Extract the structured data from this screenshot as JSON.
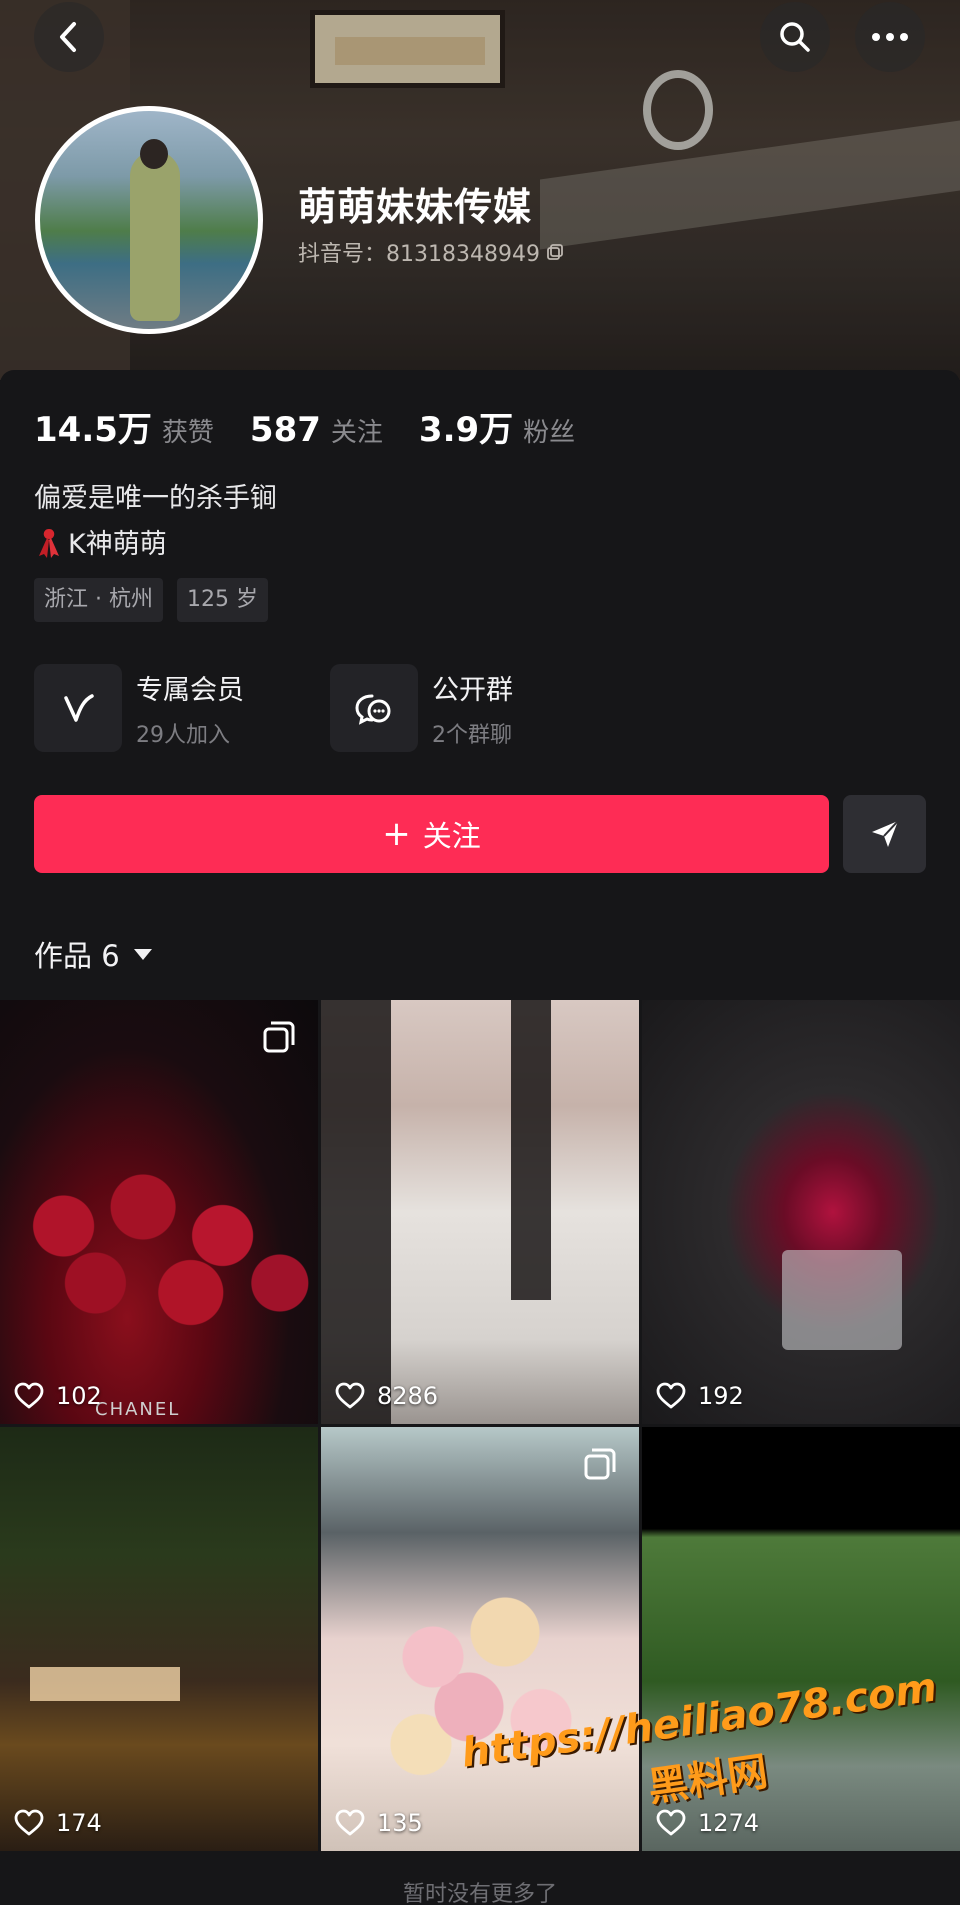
{
  "profile": {
    "name": "萌萌妹妹传媒",
    "douyin_id": "抖音号：81318348949",
    "stats": {
      "likes": {
        "value": "14.5万",
        "label": "获赞"
      },
      "following": {
        "value": "587",
        "label": "关注"
      },
      "followers": {
        "value": "3.9万",
        "label": "粉丝"
      }
    },
    "bio_line1": "偏爱是唯一的杀手锏",
    "bio_line2": "K神萌萌",
    "tags": [
      "浙江 · 杭州",
      "125 岁"
    ]
  },
  "features": [
    {
      "title": "专属会员",
      "subtitle": "29人加入",
      "icon": "vip-v-icon"
    },
    {
      "title": "公开群",
      "subtitle": "2个群聊",
      "icon": "group-chat-icon"
    }
  ],
  "actions": {
    "follow_label": "关注",
    "share_icon": "send-icon"
  },
  "works": {
    "tab_label": "作品 6",
    "items": [
      {
        "likes": "102",
        "multi_image": true,
        "brand_text": "CHANEL"
      },
      {
        "likes": "8286",
        "multi_image": false
      },
      {
        "likes": "192",
        "multi_image": false
      },
      {
        "likes": "174",
        "multi_image": false
      },
      {
        "likes": "135",
        "multi_image": true
      },
      {
        "likes": "1274",
        "multi_image": false
      }
    ],
    "no_more": "暂时没有更多了"
  },
  "watermark": {
    "url": "https://heiliao78.com",
    "label": "黑料网"
  },
  "colors": {
    "accent": "#fe2c55",
    "background": "#161618",
    "watermark": "#ff9b1a"
  }
}
